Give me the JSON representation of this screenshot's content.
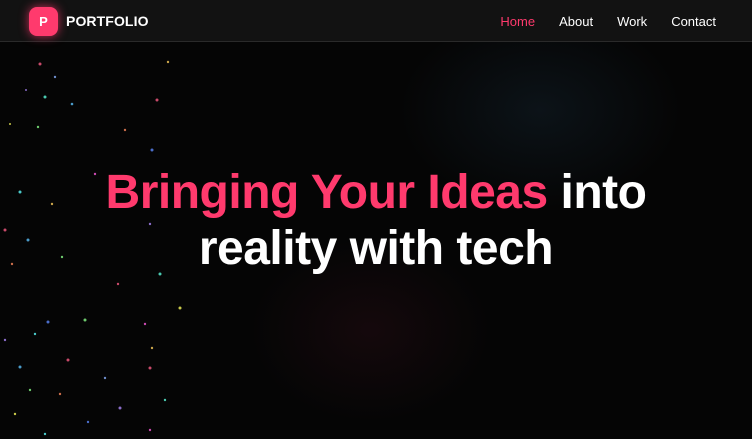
{
  "navbar": {
    "logo_letter": "P",
    "brand": "PORTFOLIO",
    "links": [
      "Home",
      "About",
      "Work",
      "Contact"
    ],
    "active": "Home"
  },
  "hero": {
    "line1_accent": "Bringing Your Ideas",
    "line1_rest": "into",
    "line2": "reality with tech"
  },
  "colors": {
    "accent": "#ff3a6d",
    "background": "#050505",
    "navbar": "#121212",
    "text": "#ffffff"
  }
}
